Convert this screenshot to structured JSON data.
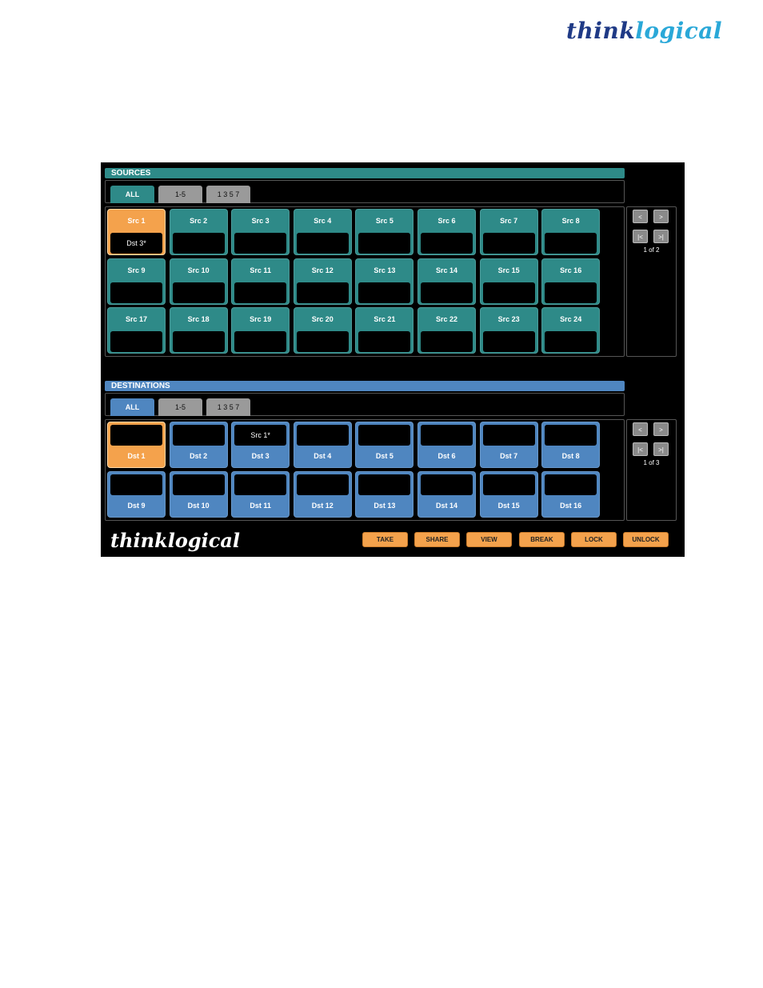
{
  "page_logo": {
    "think": "think",
    "logical": "logical"
  },
  "colors": {
    "teal": "#2e8a88",
    "blue": "#4f86c0",
    "orange": "#f4a24c",
    "gray_tab": "#9a9a9a"
  },
  "sources": {
    "header": "SOURCES",
    "tabs": [
      "ALL",
      "1-5",
      "1 3 5 7"
    ],
    "tiles": [
      {
        "label": "Src 1",
        "value": "Dst 3*"
      },
      {
        "label": "Src 2",
        "value": ""
      },
      {
        "label": "Src 3",
        "value": ""
      },
      {
        "label": "Src 4",
        "value": ""
      },
      {
        "label": "Src 5",
        "value": ""
      },
      {
        "label": "Src 6",
        "value": ""
      },
      {
        "label": "Src 7",
        "value": ""
      },
      {
        "label": "Src 8",
        "value": ""
      },
      {
        "label": "Src 9",
        "value": ""
      },
      {
        "label": "Src 10",
        "value": ""
      },
      {
        "label": "Src 11",
        "value": ""
      },
      {
        "label": "Src 12",
        "value": ""
      },
      {
        "label": "Src 13",
        "value": ""
      },
      {
        "label": "Src 14",
        "value": ""
      },
      {
        "label": "Src 15",
        "value": ""
      },
      {
        "label": "Src 16",
        "value": ""
      },
      {
        "label": "Src 17",
        "value": ""
      },
      {
        "label": "Src 18",
        "value": ""
      },
      {
        "label": "Src 19",
        "value": ""
      },
      {
        "label": "Src 20",
        "value": ""
      },
      {
        "label": "Src 21",
        "value": ""
      },
      {
        "label": "Src 22",
        "value": ""
      },
      {
        "label": "Src 23",
        "value": ""
      },
      {
        "label": "Src 24",
        "value": ""
      }
    ],
    "nav": {
      "prev": "<",
      "next": ">",
      "first": "|<",
      "last": ">|",
      "page": "1 of 2"
    }
  },
  "destinations": {
    "header": "DESTINATIONS",
    "tabs": [
      "ALL",
      "1-5",
      "1 3 5 7"
    ],
    "tiles": [
      {
        "label": "Dst 1",
        "value": ""
      },
      {
        "label": "Dst 2",
        "value": ""
      },
      {
        "label": "Dst 3",
        "value": "Src 1*"
      },
      {
        "label": "Dst 4",
        "value": ""
      },
      {
        "label": "Dst 5",
        "value": ""
      },
      {
        "label": "Dst 6",
        "value": ""
      },
      {
        "label": "Dst 7",
        "value": ""
      },
      {
        "label": "Dst 8",
        "value": ""
      },
      {
        "label": "Dst 9",
        "value": ""
      },
      {
        "label": "Dst 10",
        "value": ""
      },
      {
        "label": "Dst 11",
        "value": ""
      },
      {
        "label": "Dst 12",
        "value": ""
      },
      {
        "label": "Dst 13",
        "value": ""
      },
      {
        "label": "Dst 14",
        "value": ""
      },
      {
        "label": "Dst 15",
        "value": ""
      },
      {
        "label": "Dst 16",
        "value": ""
      }
    ],
    "nav": {
      "prev": "<",
      "next": ">",
      "first": "|<",
      "last": ">|",
      "page": "1 of 3"
    }
  },
  "bottom_logo": "thinklogical",
  "actions": [
    "TAKE",
    "SHARE",
    "VIEW",
    "BREAK",
    "LOCK",
    "UNLOCK"
  ]
}
